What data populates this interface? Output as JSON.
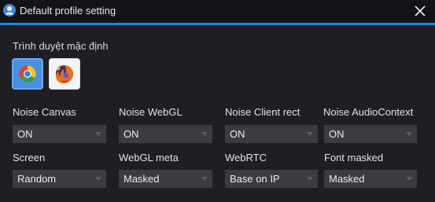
{
  "window": {
    "title": "Default profile setting",
    "title_icon": "user-icon",
    "close_icon": "close-icon",
    "accent_color": "#1a8ad4"
  },
  "default_browser": {
    "label": "Trình duyệt mặc định",
    "options": [
      {
        "name": "chrome",
        "icon": "chrome-icon",
        "selected": true
      },
      {
        "name": "firefox",
        "icon": "firefox-icon",
        "selected": false
      }
    ]
  },
  "fields": {
    "noise_canvas": {
      "label": "Noise Canvas",
      "value": "ON"
    },
    "noise_webgl": {
      "label": "Noise WebGL",
      "value": "ON"
    },
    "noise_client_rect": {
      "label": "Noise Client rect",
      "value": "ON"
    },
    "noise_audio_context": {
      "label": "Noise AudioContext",
      "value": "ON"
    },
    "screen": {
      "label": "Screen",
      "value": "Random"
    },
    "webgl_meta": {
      "label": "WebGL meta",
      "value": "Masked"
    },
    "webrtc": {
      "label": "WebRTC",
      "value": "Base on IP"
    },
    "font_masked": {
      "label": "Font masked",
      "value": "Masked"
    }
  }
}
